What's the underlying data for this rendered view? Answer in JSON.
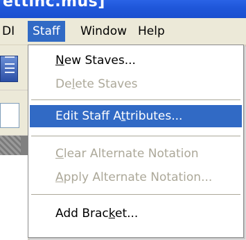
{
  "window": {
    "title_fragment": "ettinc.mus]"
  },
  "menubar": {
    "items": [
      {
        "label": "DI",
        "active": false
      },
      {
        "label": "Staff",
        "active": true
      },
      {
        "label": "Window",
        "active": false
      },
      {
        "label": "Help",
        "active": false
      }
    ]
  },
  "staff_menu": {
    "items": [
      {
        "pre": "",
        "accel": "N",
        "post": "ew Staves...",
        "state": "enabled"
      },
      {
        "pre": "De",
        "accel": "l",
        "post": "ete Staves",
        "state": "disabled"
      },
      {
        "pre": "Edit Staff A",
        "accel": "t",
        "post": "tributes...",
        "state": "highlighted"
      },
      {
        "pre": "",
        "accel": "C",
        "post": "lear Alternate Notation",
        "state": "disabled"
      },
      {
        "pre": "",
        "accel": "A",
        "post": "pply Alternate Notation...",
        "state": "disabled"
      },
      {
        "pre": "Add Brac",
        "accel": "k",
        "post": "et...",
        "state": "enabled"
      }
    ]
  },
  "colors": {
    "highlight": "#316ac5",
    "disabled_text": "#aca899",
    "menubar_bg": "#ece9d8",
    "titlebar": "#1f57da"
  }
}
